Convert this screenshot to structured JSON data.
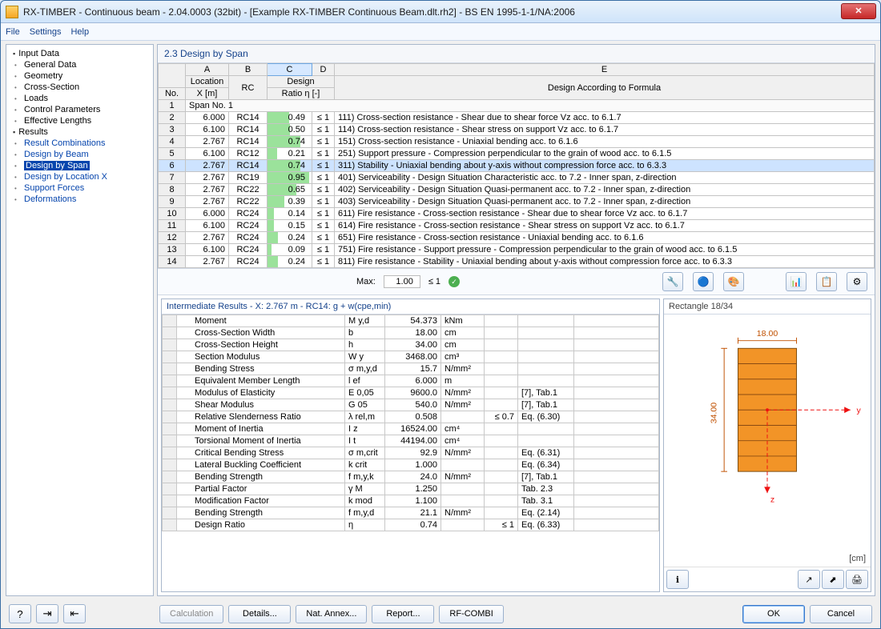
{
  "window": {
    "title": "RX-TIMBER - Continuous beam - 2.04.0003 (32bit) - [Example RX-TIMBER Continuous Beam.dlt.rh2] - BS EN 1995-1-1/NA:2006",
    "close": "✕"
  },
  "menu": {
    "file": "File",
    "settings": "Settings",
    "help": "Help"
  },
  "sidebar": {
    "input": "Input Data",
    "input_items": [
      "General Data",
      "Geometry",
      "Cross-Section",
      "Loads",
      "Control Parameters",
      "Effective Lengths"
    ],
    "results": "Results",
    "results_items": [
      "Result Combinations",
      "Design by Beam",
      "Design by Span",
      "Design by Location X",
      "Support Forces",
      "Deformations"
    ],
    "selected": "Design by Span"
  },
  "section": {
    "title": "2.3 Design by Span"
  },
  "cols": {
    "A": "A",
    "B": "B",
    "C": "C",
    "D": "D",
    "E": "E",
    "No": "No.",
    "Loc": "Location",
    "X": "X [m]",
    "RC": "RC",
    "Design": "Design",
    "Ratio": "Ratio η [-]",
    "Formula": "Design According to Formula"
  },
  "rows": [
    {
      "x": "6.000",
      "rc": "RC14",
      "ratio": "0.49",
      "lim": "≤ 1",
      "desc": "111) Cross-section resistance - Shear due to shear force Vz acc. to 6.1.7"
    },
    {
      "x": "6.100",
      "rc": "RC14",
      "ratio": "0.50",
      "lim": "≤ 1",
      "desc": "114) Cross-section resistance - Shear stress on support Vz acc. to 6.1.7"
    },
    {
      "x": "2.767",
      "rc": "RC14",
      "ratio": "0.74",
      "lim": "≤ 1",
      "desc": "151) Cross-section resistance - Uniaxial bending acc. to 6.1.6"
    },
    {
      "x": "6.100",
      "rc": "RC12",
      "ratio": "0.21",
      "lim": "≤ 1",
      "desc": "251) Support pressure - Compression perpendicular to the grain of wood acc. to 6.1.5"
    },
    {
      "x": "2.767",
      "rc": "RC14",
      "ratio": "0.74",
      "lim": "≤ 1",
      "desc": "311) Stability - Uniaxial bending about y-axis without compression force acc. to 6.3.3",
      "sel": true
    },
    {
      "x": "2.767",
      "rc": "RC19",
      "ratio": "0.95",
      "lim": "≤ 1",
      "desc": "401) Serviceability - Design Situation Characteristic acc. to 7.2 - Inner span, z-direction"
    },
    {
      "x": "2.767",
      "rc": "RC22",
      "ratio": "0.65",
      "lim": "≤ 1",
      "desc": "402) Serviceability - Design Situation Quasi-permanent acc. to 7.2 - Inner span, z-direction"
    },
    {
      "x": "2.767",
      "rc": "RC22",
      "ratio": "0.39",
      "lim": "≤ 1",
      "desc": "403) Serviceability - Design Situation Quasi-permanent acc. to 7.2 - Inner span, z-direction"
    },
    {
      "x": "6.000",
      "rc": "RC24",
      "ratio": "0.14",
      "lim": "≤ 1",
      "desc": "611) Fire resistance - Cross-section resistance - Shear due to shear force Vz acc. to 6.1.7"
    },
    {
      "x": "6.100",
      "rc": "RC24",
      "ratio": "0.15",
      "lim": "≤ 1",
      "desc": "614) Fire resistance - Cross-section resistance - Shear stress on support Vz acc. to 6.1.7"
    },
    {
      "x": "2.767",
      "rc": "RC24",
      "ratio": "0.24",
      "lim": "≤ 1",
      "desc": "651) Fire resistance - Cross-section resistance - Uniaxial bending acc. to 6.1.6"
    },
    {
      "x": "6.100",
      "rc": "RC24",
      "ratio": "0.09",
      "lim": "≤ 1",
      "desc": "751) Fire resistance - Support pressure - Compression perpendicular to the grain of wood acc. to 6.1.5"
    },
    {
      "x": "2.767",
      "rc": "RC24",
      "ratio": "0.24",
      "lim": "≤ 1",
      "desc": "811) Fire resistance - Stability - Uniaxial bending about y-axis without compression force acc. to 6.3.3"
    }
  ],
  "span_label": "Span No. 1",
  "max": {
    "label": "Max:",
    "value": "1.00",
    "lim": "≤ 1"
  },
  "inter": {
    "title": "Intermediate Results  -  X: 2.767 m  -  RC14: g + w(cpe,min)",
    "rows": [
      {
        "p": "Moment",
        "s": "M y,d",
        "v": "54.373",
        "u": "kNm",
        "l": "",
        "r": ""
      },
      {
        "p": "Cross-Section Width",
        "s": "b",
        "v": "18.00",
        "u": "cm",
        "l": "",
        "r": ""
      },
      {
        "p": "Cross-Section Height",
        "s": "h",
        "v": "34.00",
        "u": "cm",
        "l": "",
        "r": ""
      },
      {
        "p": "Section Modulus",
        "s": "W y",
        "v": "3468.00",
        "u": "cm³",
        "l": "",
        "r": ""
      },
      {
        "p": "Bending Stress",
        "s": "σ m,y,d",
        "v": "15.7",
        "u": "N/mm²",
        "l": "",
        "r": ""
      },
      {
        "p": "Equivalent Member Length",
        "s": "l ef",
        "v": "6.000",
        "u": "m",
        "l": "",
        "r": ""
      },
      {
        "p": "Modulus of Elasticity",
        "s": "E 0,05",
        "v": "9600.0",
        "u": "N/mm²",
        "l": "",
        "r": "[7], Tab.1"
      },
      {
        "p": "Shear Modulus",
        "s": "G 05",
        "v": "540.0",
        "u": "N/mm²",
        "l": "",
        "r": "[7], Tab.1"
      },
      {
        "p": "Relative Slenderness Ratio",
        "s": "λ rel,m",
        "v": "0.508",
        "u": "",
        "l": "≤ 0.7",
        "r": "Eq. (6.30)"
      },
      {
        "p": "Moment of Inertia",
        "s": "I z",
        "v": "16524.00",
        "u": "cm⁴",
        "l": "",
        "r": ""
      },
      {
        "p": "Torsional Moment of Inertia",
        "s": "I t",
        "v": "44194.00",
        "u": "cm⁴",
        "l": "",
        "r": ""
      },
      {
        "p": "Critical Bending Stress",
        "s": "σ m,crit",
        "v": "92.9",
        "u": "N/mm²",
        "l": "",
        "r": "Eq. (6.31)"
      },
      {
        "p": "Lateral Buckling Coefficient",
        "s": "k crit",
        "v": "1.000",
        "u": "",
        "l": "",
        "r": "Eq. (6.34)"
      },
      {
        "p": "Bending Strength",
        "s": "f m,y,k",
        "v": "24.0",
        "u": "N/mm²",
        "l": "",
        "r": "[7], Tab.1"
      },
      {
        "p": "Partial Factor",
        "s": "γ M",
        "v": "1.250",
        "u": "",
        "l": "",
        "r": "Tab. 2.3"
      },
      {
        "p": "Modification Factor",
        "s": "k mod",
        "v": "1.100",
        "u": "",
        "l": "",
        "r": "Tab. 3.1"
      },
      {
        "p": "Bending Strength",
        "s": "f m,y,d",
        "v": "21.1",
        "u": "N/mm²",
        "l": "",
        "r": "Eq. (2.14)"
      },
      {
        "p": "Design Ratio",
        "s": "η",
        "v": "0.74",
        "u": "",
        "l": "≤ 1",
        "r": "Eq. (6.33)"
      }
    ]
  },
  "diagram": {
    "title": "Rectangle 18/34",
    "w": "18.00",
    "h": "34.00",
    "unit": "[cm]",
    "y": "y",
    "z": "z"
  },
  "footer": {
    "calculation": "Calculation",
    "details": "Details...",
    "nat": "Nat. Annex...",
    "report": "Report...",
    "rfcombi": "RF-COMBI",
    "ok": "OK",
    "cancel": "Cancel",
    "help": "?"
  }
}
